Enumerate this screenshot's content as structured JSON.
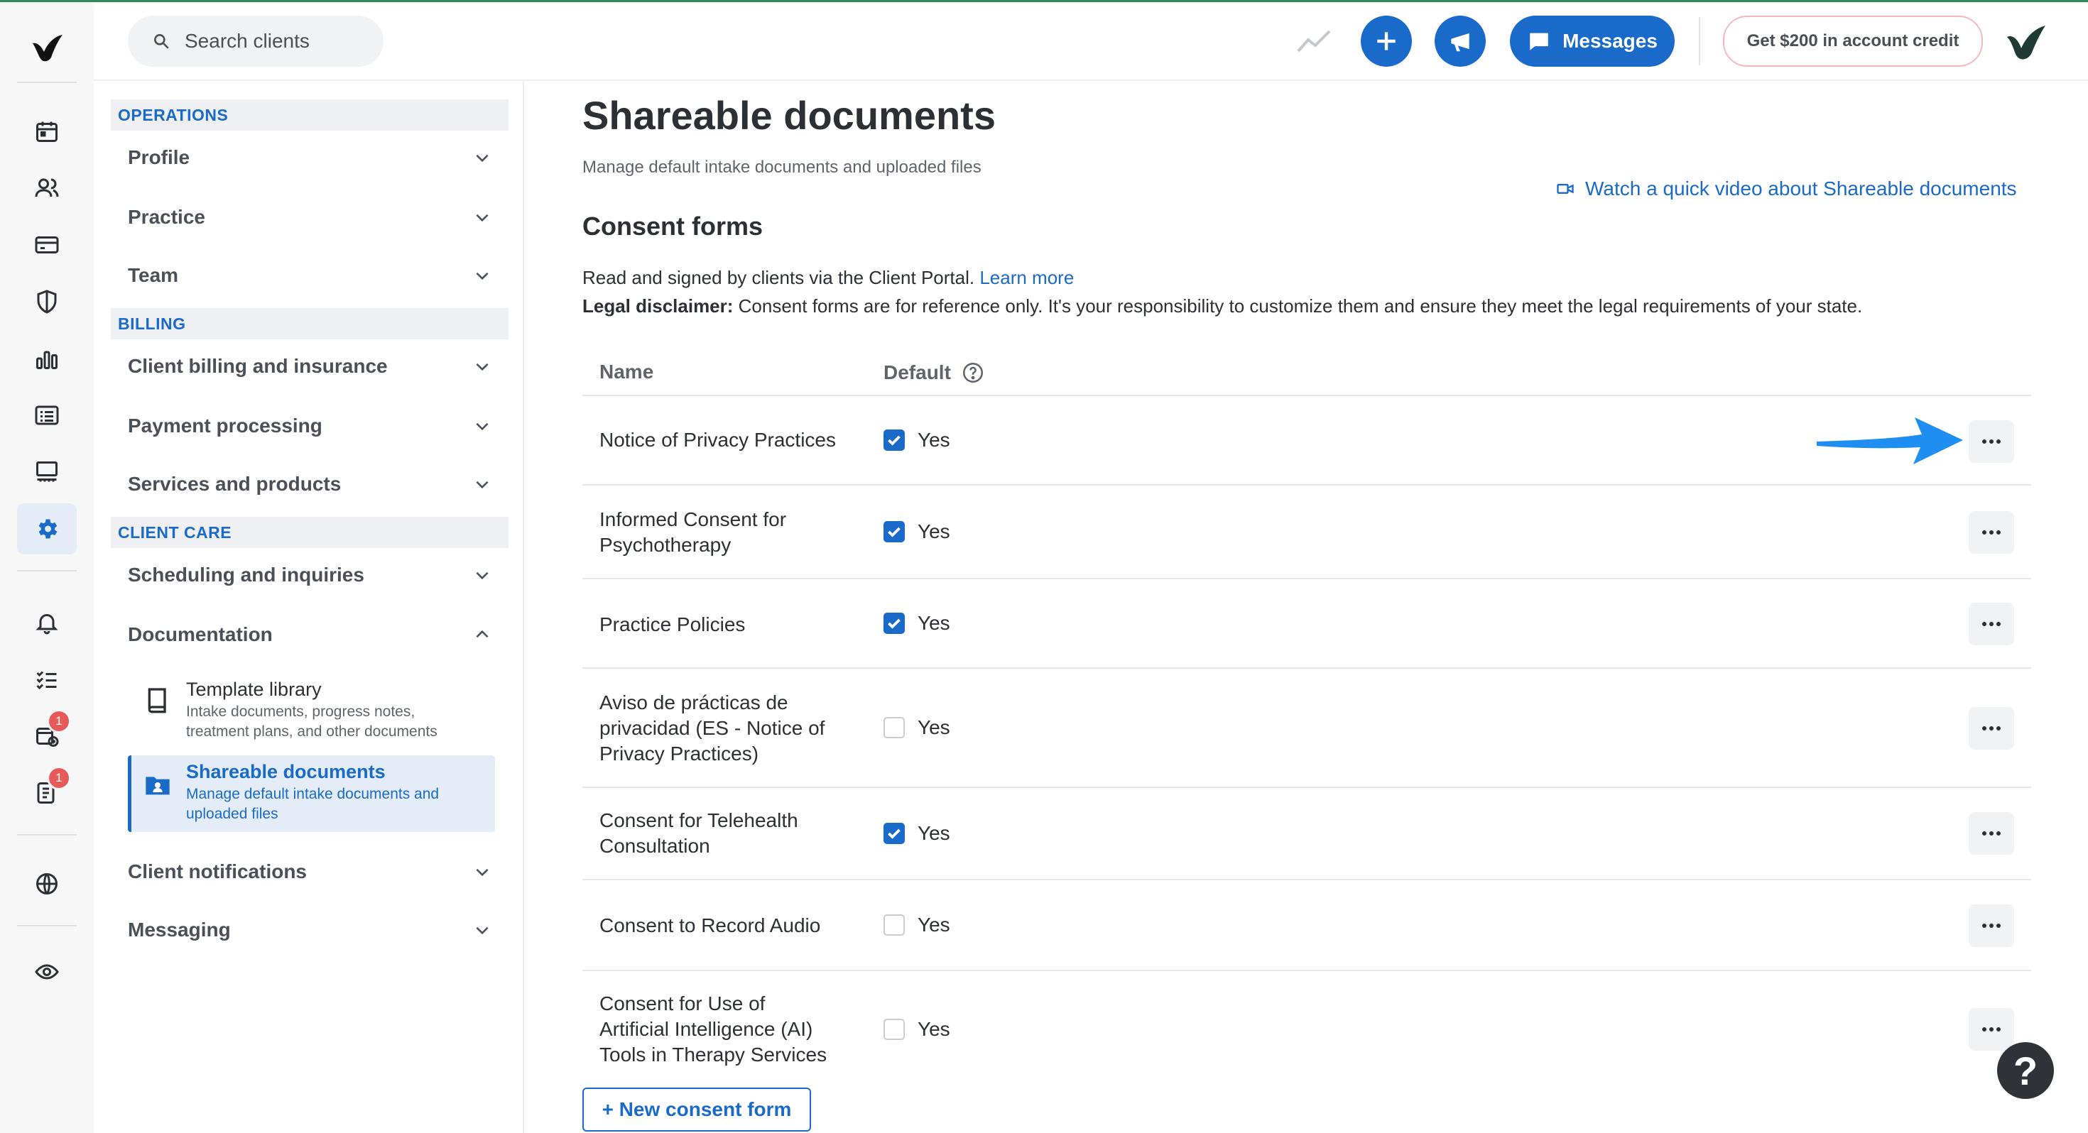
{
  "topbar": {
    "search_placeholder": "Search clients",
    "messages_label": "Messages",
    "credit_label": "Get $200 in account credit"
  },
  "rail": {
    "badge_count_1": "1",
    "badge_count_2": "1"
  },
  "nav": {
    "sections": [
      {
        "label": "OPERATIONS"
      },
      {
        "label": "BILLING"
      },
      {
        "label": "CLIENT CARE"
      }
    ],
    "items": {
      "profile": "Profile",
      "practice": "Practice",
      "team": "Team",
      "client_billing": "Client billing and insurance",
      "payment_processing": "Payment processing",
      "services_products": "Services and products",
      "scheduling": "Scheduling and inquiries",
      "documentation": "Documentation",
      "client_notifications": "Client notifications",
      "messaging": "Messaging"
    },
    "sub_items": {
      "template_library": {
        "title": "Template library",
        "line1": "Intake documents, progress notes,",
        "line2": "treatment plans, and other documents"
      },
      "shareable_documents": {
        "title": "Shareable documents",
        "line1": "Manage default intake documents and",
        "line2": "uploaded files"
      }
    }
  },
  "main": {
    "title": "Shareable documents",
    "subtitle": "Manage default intake documents and uploaded files",
    "video_link": "Watch a quick video about Shareable documents",
    "section_title": "Consent forms",
    "desc_text": "Read and signed by clients via the Client Portal.",
    "learn_more": "Learn more",
    "legal_label": "Legal disclaimer:",
    "legal_text": " Consent forms are for reference only. It's your responsibility to customize them and ensure they meet the legal requirements of your state.",
    "col_name": "Name",
    "col_default": "Default",
    "default_yes": "Yes",
    "rows": [
      {
        "lines": [
          "Notice of Privacy Practices"
        ],
        "checked": true
      },
      {
        "lines": [
          "Informed Consent for",
          "Psychotherapy"
        ],
        "checked": true
      },
      {
        "lines": [
          "Practice Policies"
        ],
        "checked": true
      },
      {
        "lines": [
          "Aviso de prácticas de",
          "privacidad (ES - Notice of",
          "Privacy Practices)"
        ],
        "checked": false
      },
      {
        "lines": [
          "Consent for Telehealth",
          "Consultation"
        ],
        "checked": true
      },
      {
        "lines": [
          "Consent to Record Audio"
        ],
        "checked": false
      },
      {
        "lines": [
          "Consent for Use of",
          "Artificial Intelligence (AI)",
          "Tools in Therapy Services"
        ],
        "checked": false
      }
    ],
    "new_button": "+ New consent form",
    "help_label": "?"
  },
  "colors": {
    "accent": "#1a6ac9",
    "brand_green": "#2f8a56",
    "badge": "#e65a5a"
  },
  "icons": [
    "search-icon",
    "trend-icon",
    "plus-icon",
    "megaphone-icon",
    "chat-icon",
    "calendar-icon",
    "clients-icon",
    "billing-icon",
    "shield-icon",
    "chart-icon",
    "list-icon",
    "analytics-icon",
    "gear-icon",
    "bell-icon",
    "tasks-icon",
    "calendar-add-icon",
    "form-icon",
    "globe-icon",
    "eye-icon",
    "chevron-down-icon",
    "chevron-up-icon",
    "book-icon",
    "folder-person-icon",
    "video-icon",
    "help-circle-icon",
    "more-icon",
    "arrow-icon"
  ]
}
